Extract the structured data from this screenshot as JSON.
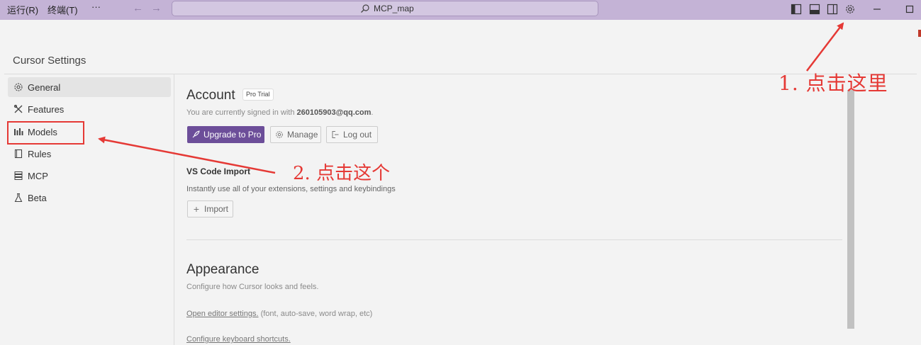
{
  "menubar": {
    "run": "运行(R)",
    "terminal": "终端(T)",
    "more": "···"
  },
  "search": {
    "text": "MCP_map"
  },
  "settings": {
    "title": "Cursor Settings"
  },
  "sidebar": {
    "items": [
      {
        "label": "General",
        "icon": "gear-icon",
        "active": true
      },
      {
        "label": "Features",
        "icon": "tools-icon"
      },
      {
        "label": "Models",
        "icon": "bar-chart-icon"
      },
      {
        "label": "Rules",
        "icon": "book-icon"
      },
      {
        "label": "MCP",
        "icon": "server-icon"
      },
      {
        "label": "Beta",
        "icon": "flask-icon"
      }
    ]
  },
  "account": {
    "heading": "Account",
    "badge": "Pro Trial",
    "signed_in_prefix": "You are currently signed in with ",
    "email": "260105903@qq.com",
    "signed_in_suffix": ".",
    "upgrade_label": "Upgrade to Pro",
    "manage_label": "Manage",
    "logout_label": "Log out"
  },
  "vscode_import": {
    "heading": "VS Code Import",
    "description": "Instantly use all of your extensions, settings and keybindings",
    "import_label": "Import"
  },
  "appearance": {
    "heading": "Appearance",
    "description": "Configure how Cursor looks and feels.",
    "open_editor_link": "Open editor settings.",
    "open_editor_note": " (font, auto-save, word wrap, etc)",
    "keyboard_link": "Configure keyboard shortcuts."
  },
  "annotations": {
    "step1": "1.  点击这里",
    "step2": "2. 点击这个"
  },
  "colors": {
    "titlebar": "#c4b3d6",
    "accent": "#6c4e99",
    "annotation_red": "#e53935"
  }
}
